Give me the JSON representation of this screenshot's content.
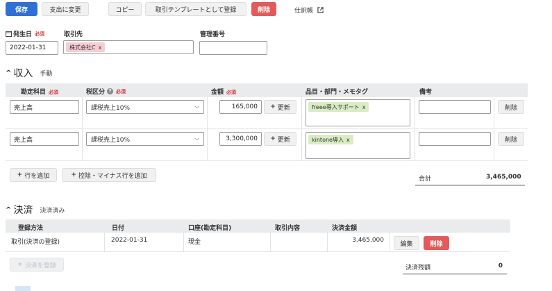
{
  "toolbar": {
    "save": "保存",
    "change_payment": "支出に変更",
    "copy": "コピー",
    "register_template": "取引テンプレートとして登録",
    "delete": "削除",
    "journal": "仕訳帳"
  },
  "form": {
    "date_label": "発生日",
    "required": "必須",
    "date_value": "2022-01-31",
    "partner_label": "取引先",
    "partner_tag": "株式会社C",
    "mgmt_label": "管理番号",
    "mgmt_value": ""
  },
  "income": {
    "title": "収入",
    "mode": "手動",
    "headers": {
      "account": "勘定科目",
      "tax": "税区分",
      "amount": "金額",
      "items": "品目・部門・メモタグ",
      "notes": "備考"
    },
    "rows": [
      {
        "account": "売上高",
        "tax": "課税売上10%",
        "amount": "165,000",
        "update": "更新",
        "tag": "freee導入サポート",
        "notes": "",
        "delete": "削除"
      },
      {
        "account": "売上高",
        "tax": "課税売上10%",
        "amount": "3,300,000",
        "update": "更新",
        "tag": "kintone導入",
        "notes": "",
        "delete": "削除"
      }
    ],
    "add_row": "行を追加",
    "add_deduction_row": "控除・マイナス行を追加",
    "total_label": "合計",
    "total_value": "3,465,000"
  },
  "settlement": {
    "title": "決済",
    "status": "決済済み",
    "headers": {
      "method": "登録方法",
      "date": "日付",
      "account": "口座(勘定科目)",
      "content": "取引内容",
      "amount": "決済金額"
    },
    "rows": [
      {
        "method": "取引(決済の登録)",
        "date": "2022-01-31",
        "account": "現金",
        "content": "",
        "amount": "3,465,000",
        "edit": "編集",
        "delete": "削除"
      }
    ],
    "register": "決済を登録",
    "balance_label": "決済残額",
    "balance_value": "0"
  },
  "colors": {
    "primary": "#2f6fd6",
    "danger": "#e25a5a",
    "tag_green": "#d9ecc4",
    "tag_pink": "#f5cdd2",
    "header_bg": "#e9ebed"
  }
}
